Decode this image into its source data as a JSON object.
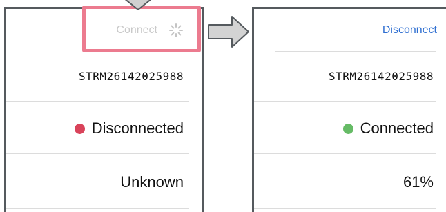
{
  "before": {
    "connect_label": "Connect",
    "serial": "STRM26142025988",
    "status_label": "Disconnected",
    "status_color": "#d9435a",
    "battery": "Unknown"
  },
  "after": {
    "disconnect_label": "Disconnect",
    "serial": "STRM26142025988",
    "status_label": "Connected",
    "status_color": "#66bb66",
    "battery": "61%"
  },
  "colors": {
    "link": "#2f6fd1",
    "highlight": "#ec7b8f",
    "frame": "#555a5e"
  }
}
